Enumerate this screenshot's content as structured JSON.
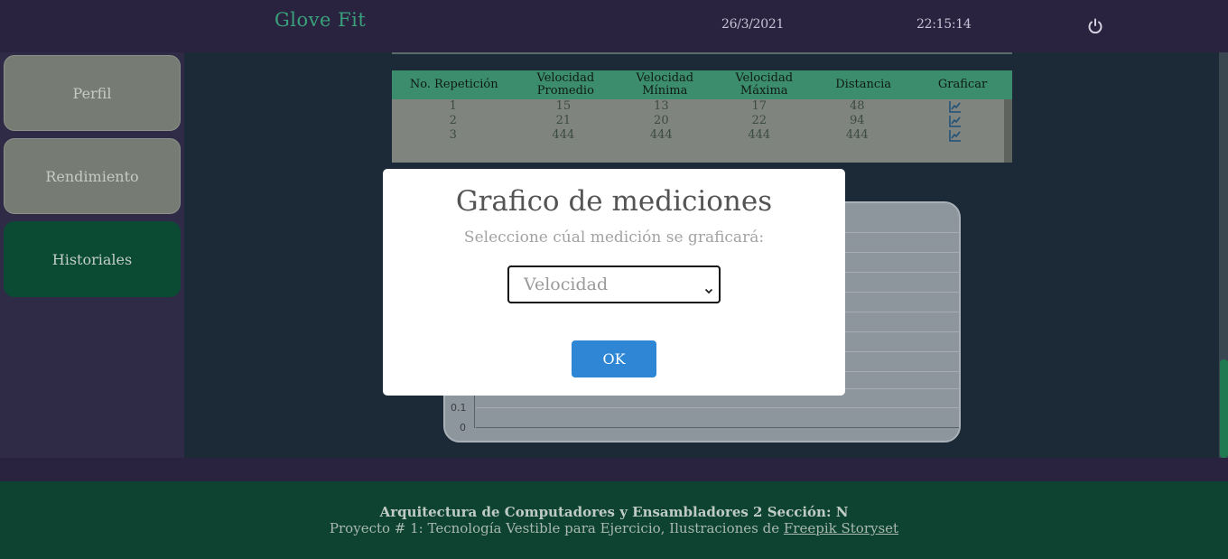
{
  "header": {
    "brand": "Glove Fit",
    "date": "26/3/2021",
    "time": "22:15:14",
    "power_icon": "power-icon"
  },
  "sidebar": {
    "items": [
      {
        "label": "Perfil",
        "active": false
      },
      {
        "label": "Rendimiento",
        "active": false
      },
      {
        "label": "Historiales",
        "active": true
      }
    ]
  },
  "table": {
    "headers": [
      "No. Repetición",
      "Velocidad Promedio",
      "Velocidad Mínima",
      "Velocidad Máxima",
      "Distancia",
      "Graficar"
    ],
    "rows": [
      {
        "rep": "1",
        "prom": "15",
        "min": "13",
        "max": "17",
        "dist": "48"
      },
      {
        "rep": "2",
        "prom": "21",
        "min": "20",
        "max": "22",
        "dist": "94"
      },
      {
        "rep": "3",
        "prom": "444",
        "min": "444",
        "max": "444",
        "dist": "444"
      }
    ]
  },
  "background_chart": {
    "y_ticks": [
      "0.1",
      "0"
    ]
  },
  "modal": {
    "title": "Grafico de mediciones",
    "subtitle": "Seleccione cúal medición se graficará:",
    "select_value": "Velocidad",
    "ok_label": "OK"
  },
  "footer": {
    "line1": "Arquitectura de Computadores y Ensambladores 2 Sección: N",
    "line2_prefix": "Proyecto # 1: Tecnología Vestible para Ejercicio, Ilustraciones de ",
    "line2_link": "Freepik Storyset"
  },
  "colors": {
    "accent_green": "#3aa07a",
    "header_bg": "#2a2340",
    "footer_bg": "#0d4330",
    "ok_button": "#2f86d4"
  }
}
